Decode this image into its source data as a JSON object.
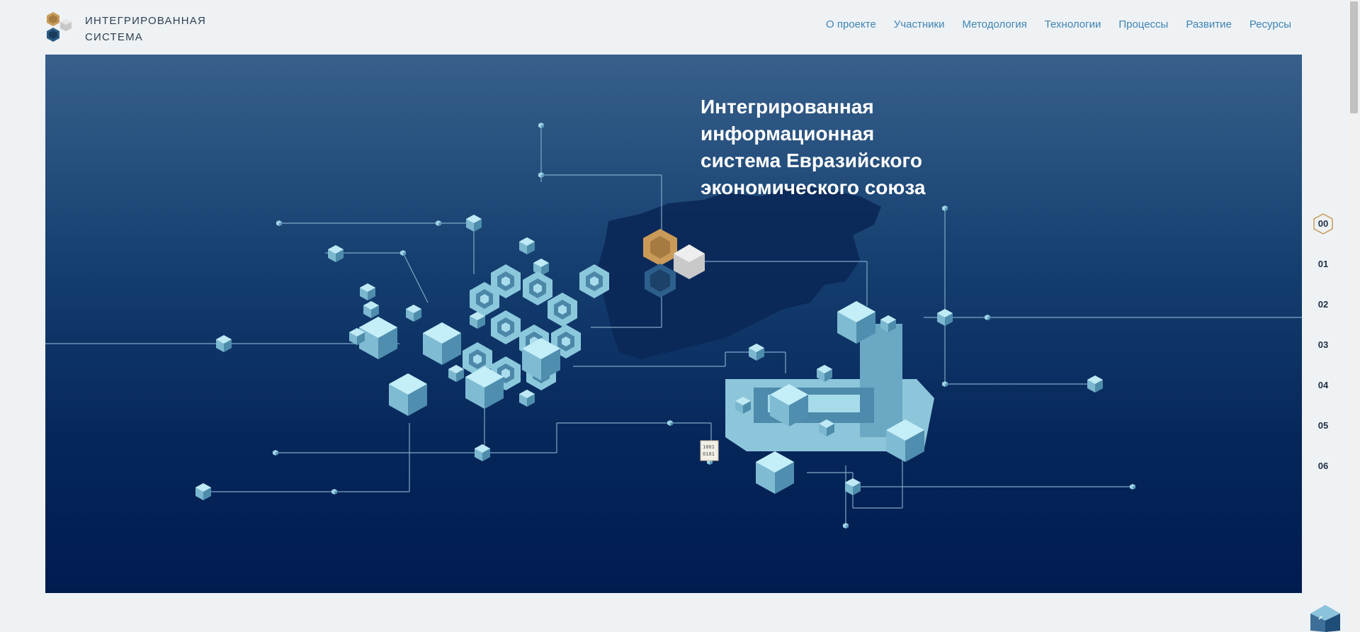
{
  "header": {
    "logo_text": "ИНТЕГРИРОВАННАЯ\nСИСТЕМА",
    "nav": [
      {
        "label": "О проекте"
      },
      {
        "label": "Участники"
      },
      {
        "label": "Методология"
      },
      {
        "label": "Технологии"
      },
      {
        "label": "Процессы"
      },
      {
        "label": "Развитие"
      },
      {
        "label": "Ресурсы"
      }
    ]
  },
  "hero": {
    "title": "Интегрированная\nинформационная\nсистема Евразийского\nэкономического союза",
    "binary_label_1": "1001",
    "binary_label_2": "0101"
  },
  "pager": {
    "items": [
      "00",
      "01",
      "02",
      "03",
      "04",
      "05",
      "06"
    ],
    "active": "00"
  },
  "colors": {
    "accent": "#3f84b5",
    "hero_top": "#37608b",
    "hero_bottom": "#001b4f",
    "cube_light": "#a9dfee",
    "gold": "#c99a58"
  },
  "icons": {
    "logo": "hexagon-cubes-logo",
    "scroll_top": "cube-up-icon"
  }
}
